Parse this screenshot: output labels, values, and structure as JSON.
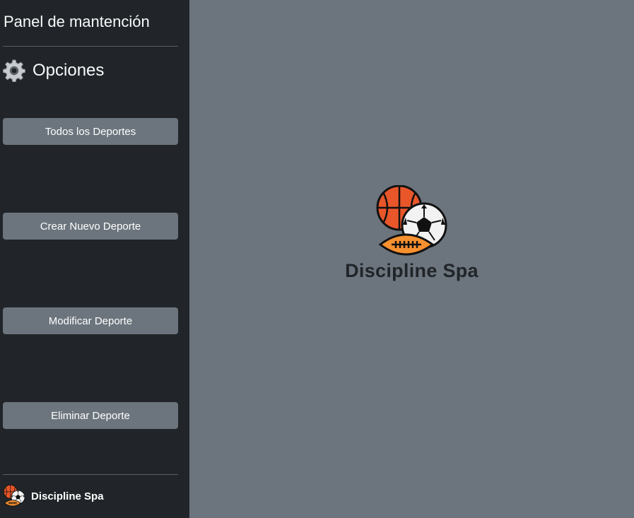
{
  "sidebar": {
    "title": "Panel de mantención",
    "options_heading": {
      "label": "Opciones",
      "icon": "gear-icon"
    },
    "buttons": [
      {
        "label": "Todos los Deportes"
      },
      {
        "label": "Crear Nuevo Deporte"
      },
      {
        "label": "Modificar Deporte"
      },
      {
        "label": "Eliminar Deporte"
      }
    ],
    "footer": {
      "brand_name": "Discipline Spa",
      "icon": "sports-balls-logo-icon"
    }
  },
  "main": {
    "brand_name": "Discipline Spa",
    "logo_icon": "sports-balls-logo-icon"
  },
  "colors": {
    "sidebar_bg": "#212529",
    "main_bg": "#6c757d",
    "button_bg": "#6c757d",
    "basketball": "#e8562a",
    "football": "#f7902f"
  }
}
